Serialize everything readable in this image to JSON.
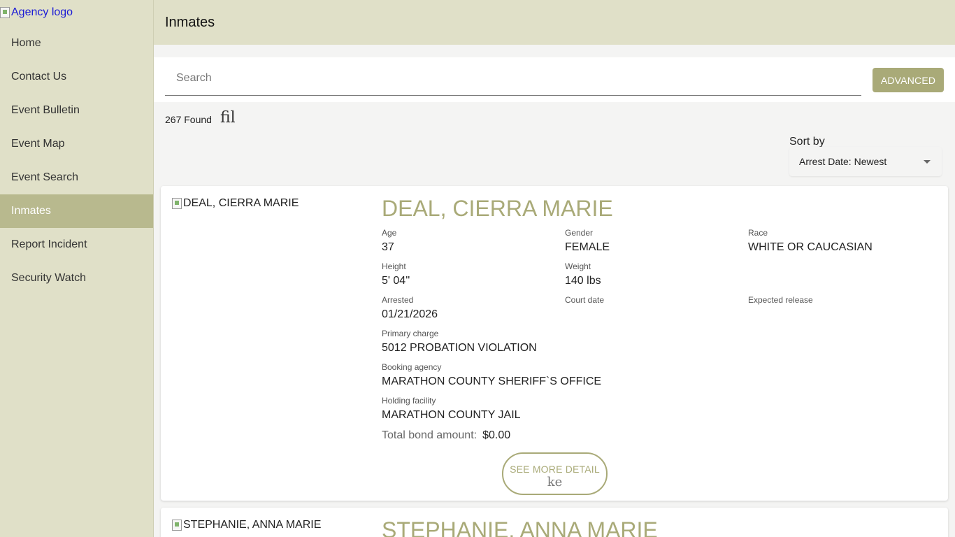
{
  "sidebar": {
    "logo_alt": "Agency logo",
    "items": [
      {
        "label": "Home"
      },
      {
        "label": "Contact Us"
      },
      {
        "label": "Event Bulletin"
      },
      {
        "label": "Event Map"
      },
      {
        "label": "Event Search"
      },
      {
        "label": "Inmates",
        "active": true
      },
      {
        "label": "Report Incident"
      },
      {
        "label": "Security Watch"
      }
    ]
  },
  "header": {
    "title": "Inmates"
  },
  "search": {
    "placeholder": "Search",
    "value": "",
    "advanced_label": "ADVANCED"
  },
  "results": {
    "found_text": "267 Found",
    "filter_icon_text": "fil"
  },
  "sort": {
    "label": "Sort by",
    "selected": "Arrest Date: Newest"
  },
  "inmates": [
    {
      "photo_alt": "DEAL, CIERRA MARIE",
      "name": "DEAL, CIERRA MARIE",
      "age_label": "Age",
      "age": "37",
      "gender_label": "Gender",
      "gender": "FEMALE",
      "race_label": "Race",
      "race": "WHITE OR CAUCASIAN",
      "height_label": "Height",
      "height": "5' 04''",
      "weight_label": "Weight",
      "weight": "140 lbs",
      "arrested_label": "Arrested",
      "arrested": "01/21/2026",
      "court_label": "Court date",
      "court": "",
      "release_label": "Expected release",
      "release": "",
      "charge_label": "Primary charge",
      "charge": "5012 PROBATION VIOLATION",
      "agency_label": "Booking agency",
      "agency": "MARATHON COUNTY SHERIFF`S OFFICE",
      "facility_label": "Holding facility",
      "facility": "MARATHON COUNTY JAIL",
      "bond_label": "Total bond amount:",
      "bond": "$0.00",
      "details_label": "SEE MORE DETAIL",
      "details_icon_text": "ke"
    },
    {
      "photo_alt": "STEPHANIE, ANNA MARIE",
      "name": "STEPHANIE, ANNA MARIE"
    }
  ],
  "colors": {
    "accent": "#a9aa78",
    "sidebar_bg": "#e0e0c8",
    "active_item": "#b8b98e"
  }
}
